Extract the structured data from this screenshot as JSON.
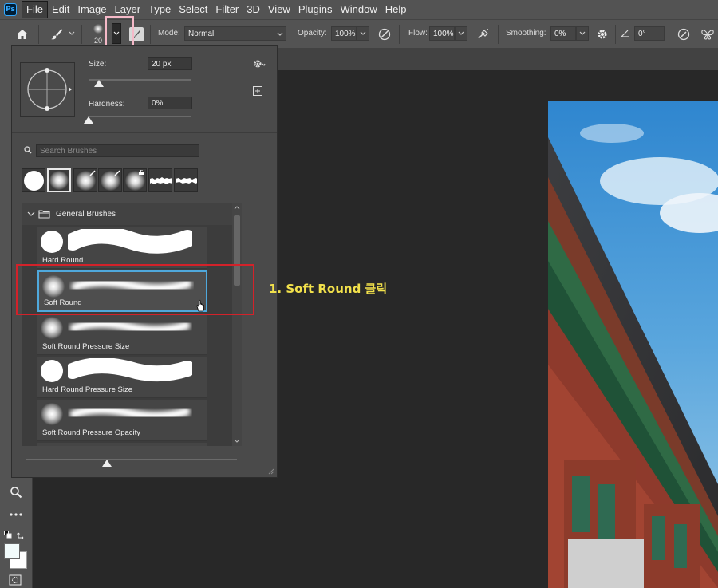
{
  "menu": {
    "logo": "Ps",
    "items": [
      "File",
      "Edit",
      "Image",
      "Layer",
      "Type",
      "Select",
      "Filter",
      "3D",
      "View",
      "Plugins",
      "Window",
      "Help"
    ]
  },
  "options": {
    "brush_size_small": "20",
    "mode_label": "Mode:",
    "mode_value": "Normal",
    "opacity_label": "Opacity:",
    "opacity_value": "100%",
    "flow_label": "Flow:",
    "flow_value": "100%",
    "smoothing_label": "Smoothing:",
    "smoothing_value": "0%",
    "angle_value": "0°"
  },
  "brush_panel": {
    "size_label": "Size:",
    "size_value": "20 px",
    "hardness_label": "Hardness:",
    "hardness_value": "0%",
    "search_placeholder": "Search Brushes",
    "group_name": "General Brushes",
    "brushes": [
      {
        "name": "Hard Round"
      },
      {
        "name": "Soft Round"
      },
      {
        "name": "Soft Round Pressure Size"
      },
      {
        "name": "Hard Round Pressure Size"
      },
      {
        "name": "Soft Round Pressure Opacity"
      }
    ],
    "size_slider_fraction": 0.1,
    "hardness_slider_fraction": 0.0
  },
  "annotation": {
    "text": "1. Soft Round 클릭",
    "color": "#f2e14b",
    "box_color": "#d3222a"
  },
  "colors": {
    "selection_outline": "#4fa8dc",
    "picker_highlight": "#f5b9c8"
  }
}
